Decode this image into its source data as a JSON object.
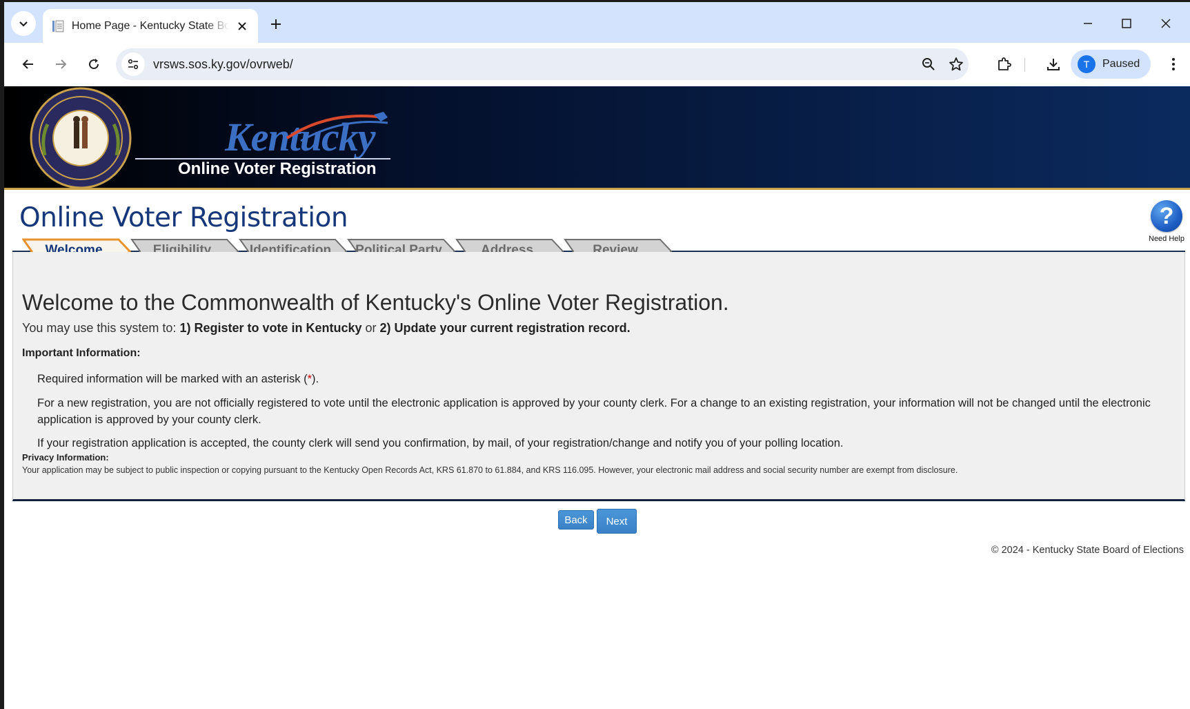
{
  "browser": {
    "tab_title": "Home Page - Kentucky State Board of Elections",
    "url": "vrsws.sos.ky.gov/ovrweb/",
    "profile_initial": "T",
    "profile_status": "Paused"
  },
  "banner": {
    "brand_script": "Kentucky",
    "brand_subtitle": "Online Voter Registration"
  },
  "page": {
    "heading": "Online Voter Registration",
    "help_label": "Need Help",
    "help_glyph": "?"
  },
  "wizard": {
    "steps": [
      {
        "label": "Welcome",
        "active": true
      },
      {
        "label": "Eligibility",
        "active": false
      },
      {
        "label": "Identification",
        "active": false
      },
      {
        "label": "Political Party",
        "active": false
      },
      {
        "label": "Address",
        "active": false
      },
      {
        "label": "Review",
        "active": false
      }
    ]
  },
  "content": {
    "welcome_title": "Welcome to the Commonwealth of Kentucky's Online Voter Registration.",
    "intro_prefix": "You may use this system to: ",
    "intro_option1": "1) Register to vote in Kentucky",
    "intro_or": " or ",
    "intro_option2": "2) Update your current registration record.",
    "important_heading": "Important Information:",
    "required_prefix": "Required information will be marked with an asterisk (",
    "asterisk": "*",
    "required_suffix": ").",
    "info_registration": "For a new registration, you are not officially registered to vote until the electronic application is approved by your county clerk. For a change to an existing registration, your information will not be changed until the electronic application is approved by your county clerk.",
    "info_confirmation": "If your registration application is accepted, the county clerk will send you confirmation, by mail, of your registration/change and notify you of your polling location.",
    "privacy_heading": "Privacy Information:",
    "privacy_text": "Your application may be subject to public inspection or copying pursuant to the Kentucky Open Records Act, KRS 61.870 to 61.884, and KRS 116.095. However, your electronic mail address and social security number are exempt from disclosure."
  },
  "buttons": {
    "back": "Back",
    "next": "Next"
  },
  "footer": {
    "copyright": "© 2024 - Kentucky State Board of Elections"
  },
  "colors": {
    "heading_blue": "#16387a",
    "active_step_border": "#e8922b",
    "button_blue": "#3b82c8"
  }
}
